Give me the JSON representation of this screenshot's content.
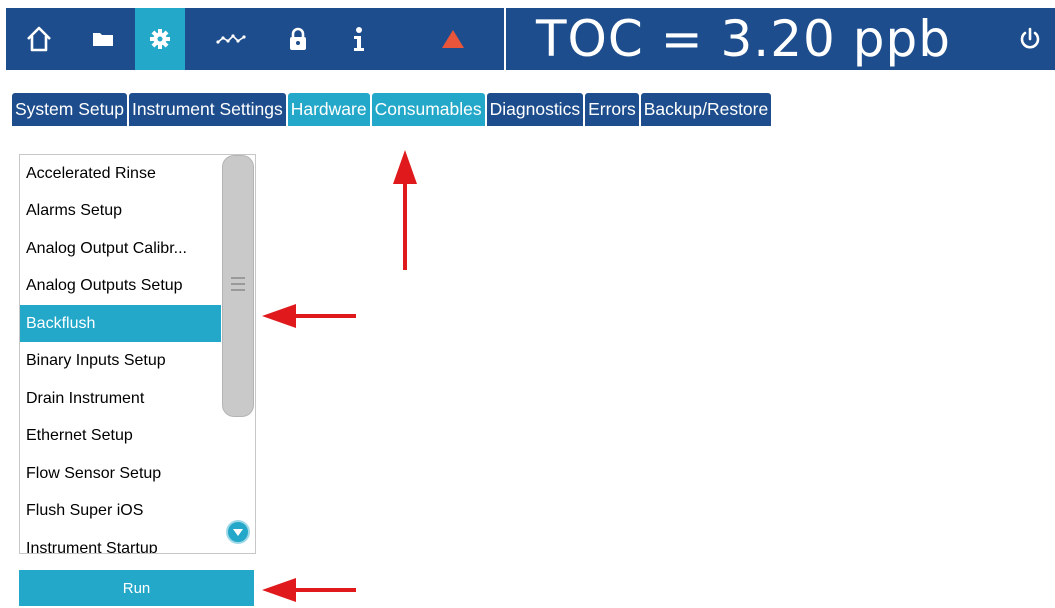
{
  "topbar": {
    "icons": [
      "home-icon",
      "folder-icon",
      "gear-icon",
      "trend-icon",
      "lock-icon",
      "info-icon",
      "alarm-icon",
      "power-icon"
    ],
    "toc_readout": "TOC = 3.20 ppb",
    "colors": {
      "bar": "#1d4d8c",
      "active": "#23a8c9",
      "alarm": "#e8553a"
    }
  },
  "tabs": [
    {
      "label": "System Setup",
      "active": false
    },
    {
      "label": "Instrument Settings",
      "active": false
    },
    {
      "label": "Hardware",
      "active": true
    },
    {
      "label": "Consumables",
      "active": true
    },
    {
      "label": "Diagnostics",
      "active": false
    },
    {
      "label": "Errors",
      "active": false
    },
    {
      "label": "Backup/Restore",
      "active": false
    }
  ],
  "hardware_list": {
    "items": [
      {
        "label": "Accelerated Rinse"
      },
      {
        "label": "Alarms Setup"
      },
      {
        "label": "Analog Output Calibr..."
      },
      {
        "label": "Analog Outputs Setup"
      },
      {
        "label": "Backflush",
        "selected": true
      },
      {
        "label": "Binary Inputs Setup"
      },
      {
        "label": "Drain Instrument"
      },
      {
        "label": "Ethernet Setup"
      },
      {
        "label": "Flow Sensor Setup"
      },
      {
        "label": "Flush Super iOS"
      },
      {
        "label": "Instrument Startup"
      }
    ],
    "scroll_down_icon": "chevron-down-icon"
  },
  "run_button": {
    "label": "Run"
  },
  "annotations": {
    "arrow_color": "#e0191c",
    "arrows": [
      "arrow-up-to-hardware-tab",
      "arrow-left-to-backflush",
      "arrow-left-to-run"
    ]
  }
}
